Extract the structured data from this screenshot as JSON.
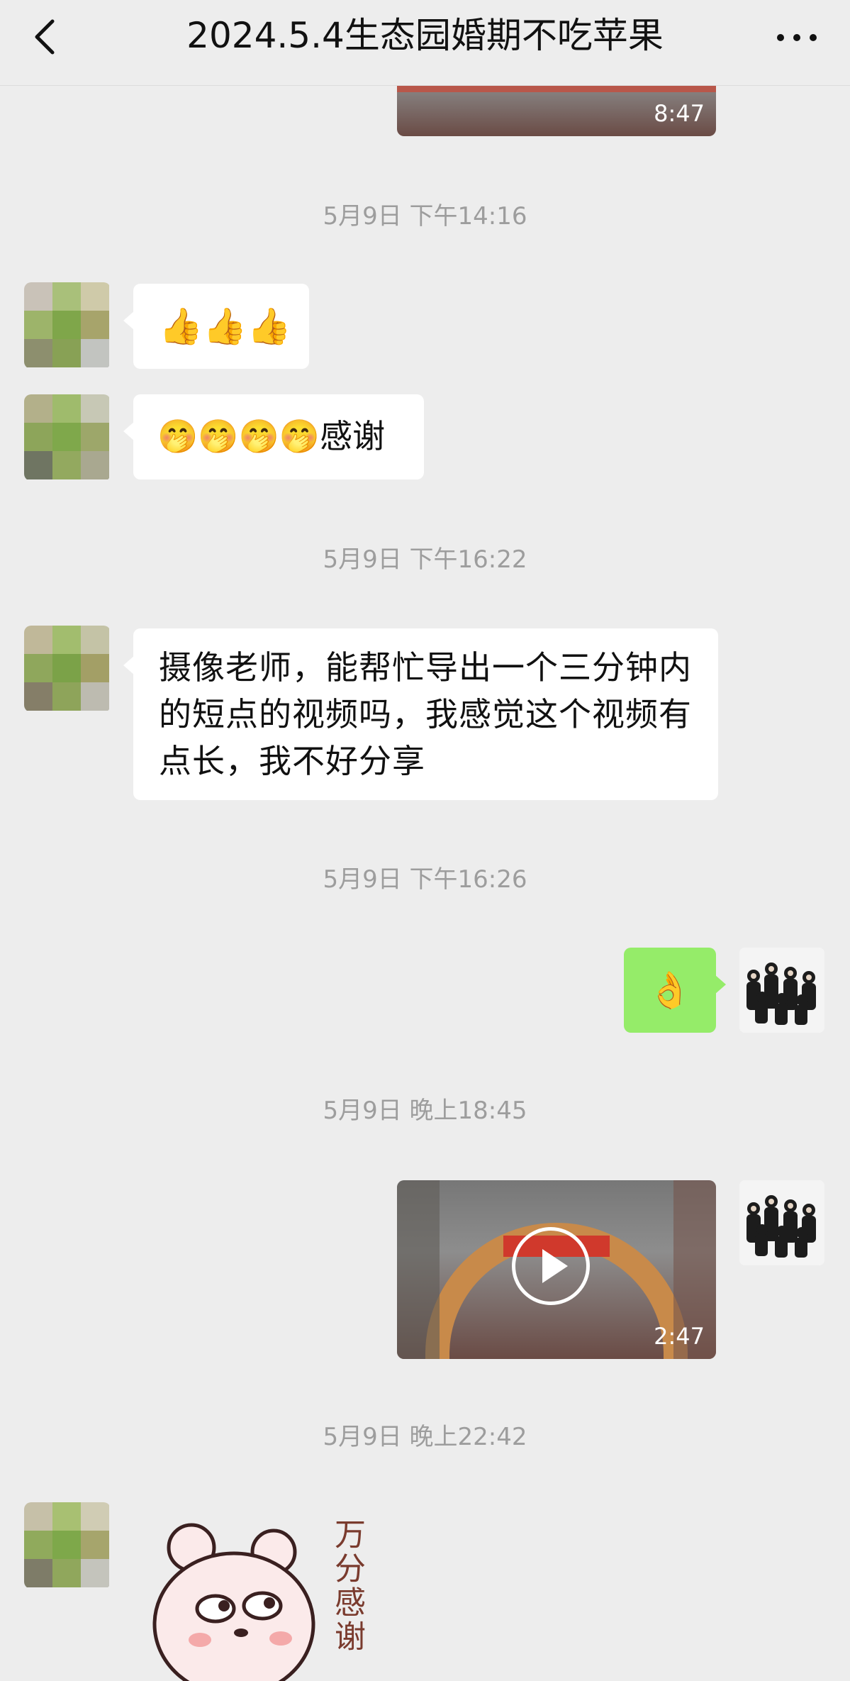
{
  "header": {
    "title": "2024.5.4生态园婚期不吃苹果",
    "back_icon": "chevron-left-icon",
    "more_icon": "more-dots-icon"
  },
  "messages": {
    "video_top_duration": "8:47",
    "ts1": "5月9日 下午14:16",
    "msg_thumbs": "👍👍👍",
    "msg_thanks_emoji": "🤭🤭🤭🤭",
    "msg_thanks_text": "感谢",
    "ts2": "5月9日 下午16:22",
    "msg_request": "摄像老师，能帮忙导出一个三分钟内的短点的视频吗，我感觉这个视频有点长，我不好分享",
    "ts3": "5月9日 下午16:26",
    "msg_ok": "👌",
    "ts4": "5月9日 晚上18:45",
    "video_duration": "2:47",
    "ts5": "5月9日 晚上22:42",
    "sticker_text": "万分感谢"
  },
  "colors": {
    "background": "#ededed",
    "bubble_self": "#95ec69",
    "bubble_other": "#ffffff",
    "timestamp": "#9d9d9d"
  }
}
